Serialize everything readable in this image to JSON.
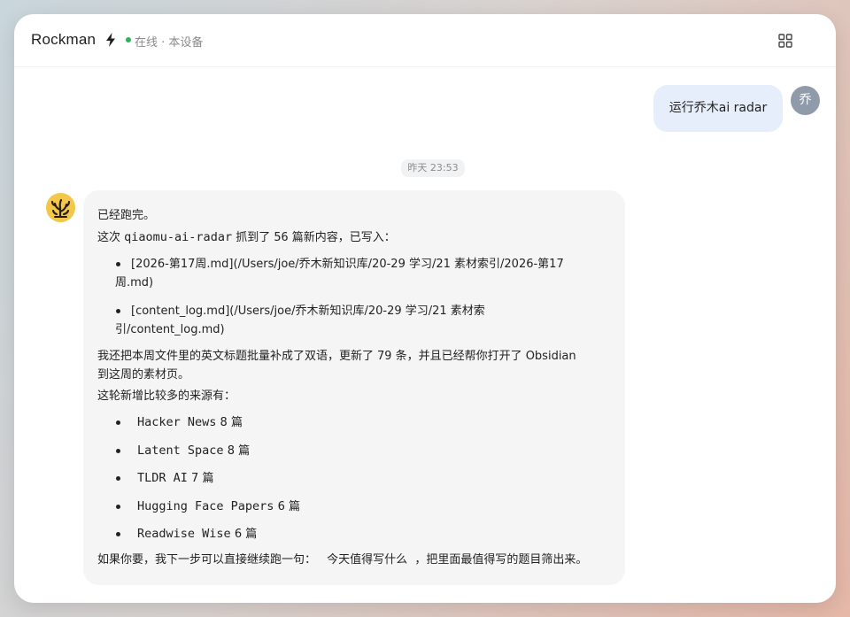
{
  "header": {
    "app_title": "Rockman",
    "status": "在线 · 本设备",
    "status_color": "#2bb55a",
    "icons": {
      "title_icon": "lightning-bolt-icon",
      "grid": "grid-icon"
    }
  },
  "user_message": {
    "text": "运行乔木ai radar",
    "avatar_text": "乔"
  },
  "timestamp": "昨天 23:53",
  "bot_message": {
    "avatar_icon": "coral-logo-icon",
    "line1": "已经跑完。",
    "line2": {
      "prefix": "这次",
      "code": "qiaomu-ai-radar",
      "mid": "抓到了",
      "count": "56",
      "suffix": "篇新内容，已写入："
    },
    "files": [
      {
        "line1": "[2026-第17周.md](/Users/joe/乔木新知识库/20-29 学习/21 素材索引/2026-第17",
        "line2": "周.md)"
      },
      {
        "line1": "[content_log.md](/Users/joe/乔木新知识库/20-29 学习/21 素材索",
        "line2": "引/content_log.md)"
      }
    ],
    "line3": {
      "prefix": "我还把本周文件里的英文标题批量补成了双语，更新了",
      "count": "79",
      "suffix": "条，并且已经帮你打开了 Obsidian"
    },
    "line3b": "到这周的素材页。",
    "sources_heading": "这轮新增比较多的来源有：",
    "sources": [
      {
        "name": "Hacker News",
        "count": "8 篇"
      },
      {
        "name": "Latent Space",
        "count": "8 篇"
      },
      {
        "name": "TLDR AI",
        "count": "7 篇"
      },
      {
        "name": "Hugging Face Papers",
        "count": "6 篇"
      },
      {
        "name": "Readwise Wise",
        "count": "6 篇"
      }
    ],
    "closing": {
      "prefix": "如果你要，我下一步可以直接继续跑一句：",
      "quote": "今天值得写什么",
      "suffix": "，把里面最值得写的题目筛出来。"
    }
  },
  "colors": {
    "user_bubble": "#e6eefc",
    "bot_bubble": "#f5f5f6",
    "user_avatar": "#8f9bab",
    "bot_avatar": "#f2c74a"
  }
}
